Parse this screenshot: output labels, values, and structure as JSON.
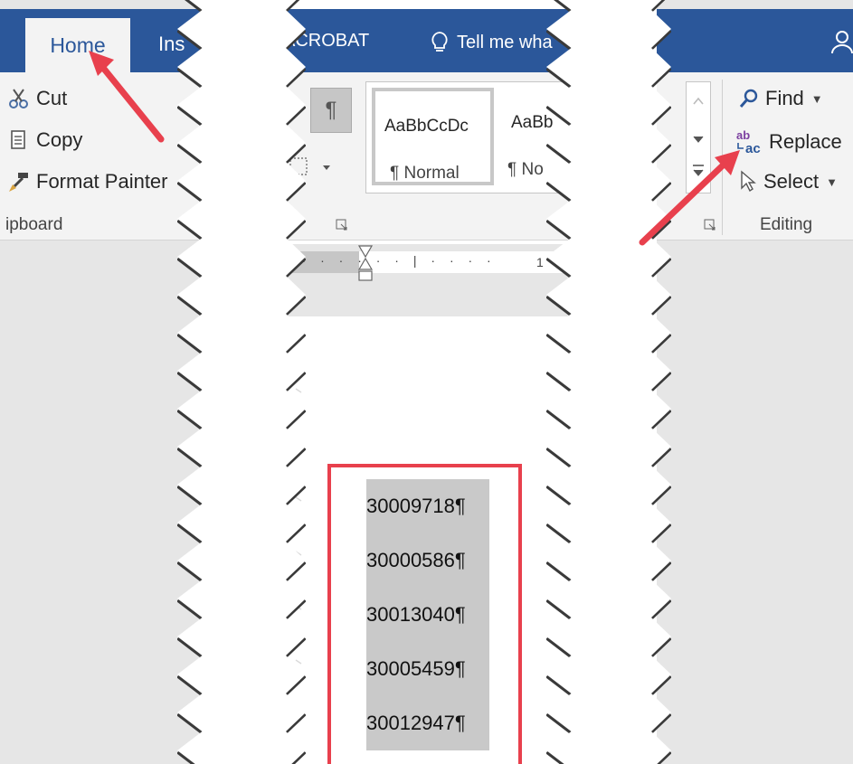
{
  "left": {
    "tabs": [
      "Home",
      "Ins"
    ],
    "clipboard": {
      "cut": "Cut",
      "copy": "Copy",
      "format_painter": "Format Painter",
      "group_label": "ipboard"
    }
  },
  "middle": {
    "titlebar": {
      "acrobat_tab": "ACROBAT",
      "tell_me": "Tell me wha"
    },
    "paragraph": {
      "show_marks_glyph": "¶"
    },
    "styles": [
      {
        "sample": "AaBbCcDc",
        "name": "¶ Normal"
      },
      {
        "sample": "AaBb",
        "name": "¶ No"
      }
    ],
    "ruler_mark": "1",
    "document": {
      "numbers": [
        "30009718¶",
        "30000586¶",
        "30013040¶",
        "30005459¶",
        "30012947¶"
      ]
    }
  },
  "right": {
    "editing": {
      "find": "Find",
      "replace": "Replace",
      "select": "Select",
      "group_label": "Editing"
    }
  },
  "colors": {
    "ribbon_blue": "#2b579a",
    "highlight_red": "#e8404d",
    "selection_gray": "#c9c9c9"
  }
}
